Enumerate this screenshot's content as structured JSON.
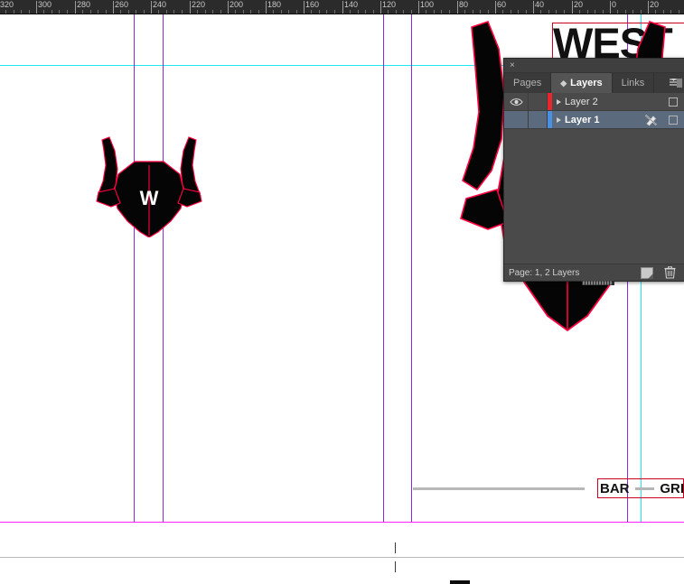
{
  "app": {
    "kind": "page-layout-editor-canvas"
  },
  "ruler": {
    "units": "mm",
    "labels": [
      "320",
      "300",
      "280",
      "260",
      "240",
      "220",
      "200",
      "180",
      "160",
      "140",
      "120",
      "100",
      "80",
      "60",
      "40",
      "20",
      "0",
      "20"
    ],
    "cursor_position_label": "80"
  },
  "artboard": {
    "headline": "WEST RO",
    "tagline_left": "BAR",
    "tagline_right": "GRI",
    "monogram": "W",
    "logo_name": "longhorn-skull-logo",
    "guide_color_vertical": "#8a2be2",
    "guide_color_horizontal": "#1de9f0",
    "page_edge_color": "#ff22ff",
    "selection_frame_color": "#cc0022",
    "path_outline_color": "#ff0040"
  },
  "panel": {
    "close_label": "×",
    "menu_icon": "panel-menu-icon",
    "tabs": [
      {
        "label": "Pages",
        "active": false
      },
      {
        "label": "Layers",
        "active": true
      },
      {
        "label": "Links",
        "active": false
      }
    ],
    "layers": [
      {
        "name": "Layer 2",
        "swatch": "#e8272c",
        "visible": true,
        "locked": false,
        "selected": false,
        "pen_icon": "",
        "target_icon": "target-square-icon"
      },
      {
        "name": "Layer 1",
        "swatch": "#4a90e2",
        "visible": false,
        "locked": false,
        "selected": true,
        "pen_icon": "pen-crossed-icon",
        "target_icon": "target-square-icon"
      }
    ],
    "status": "Page: 1, 2 Layers",
    "new_layer_icon": "new-layer-icon",
    "delete_layer_icon": "trash-icon"
  }
}
